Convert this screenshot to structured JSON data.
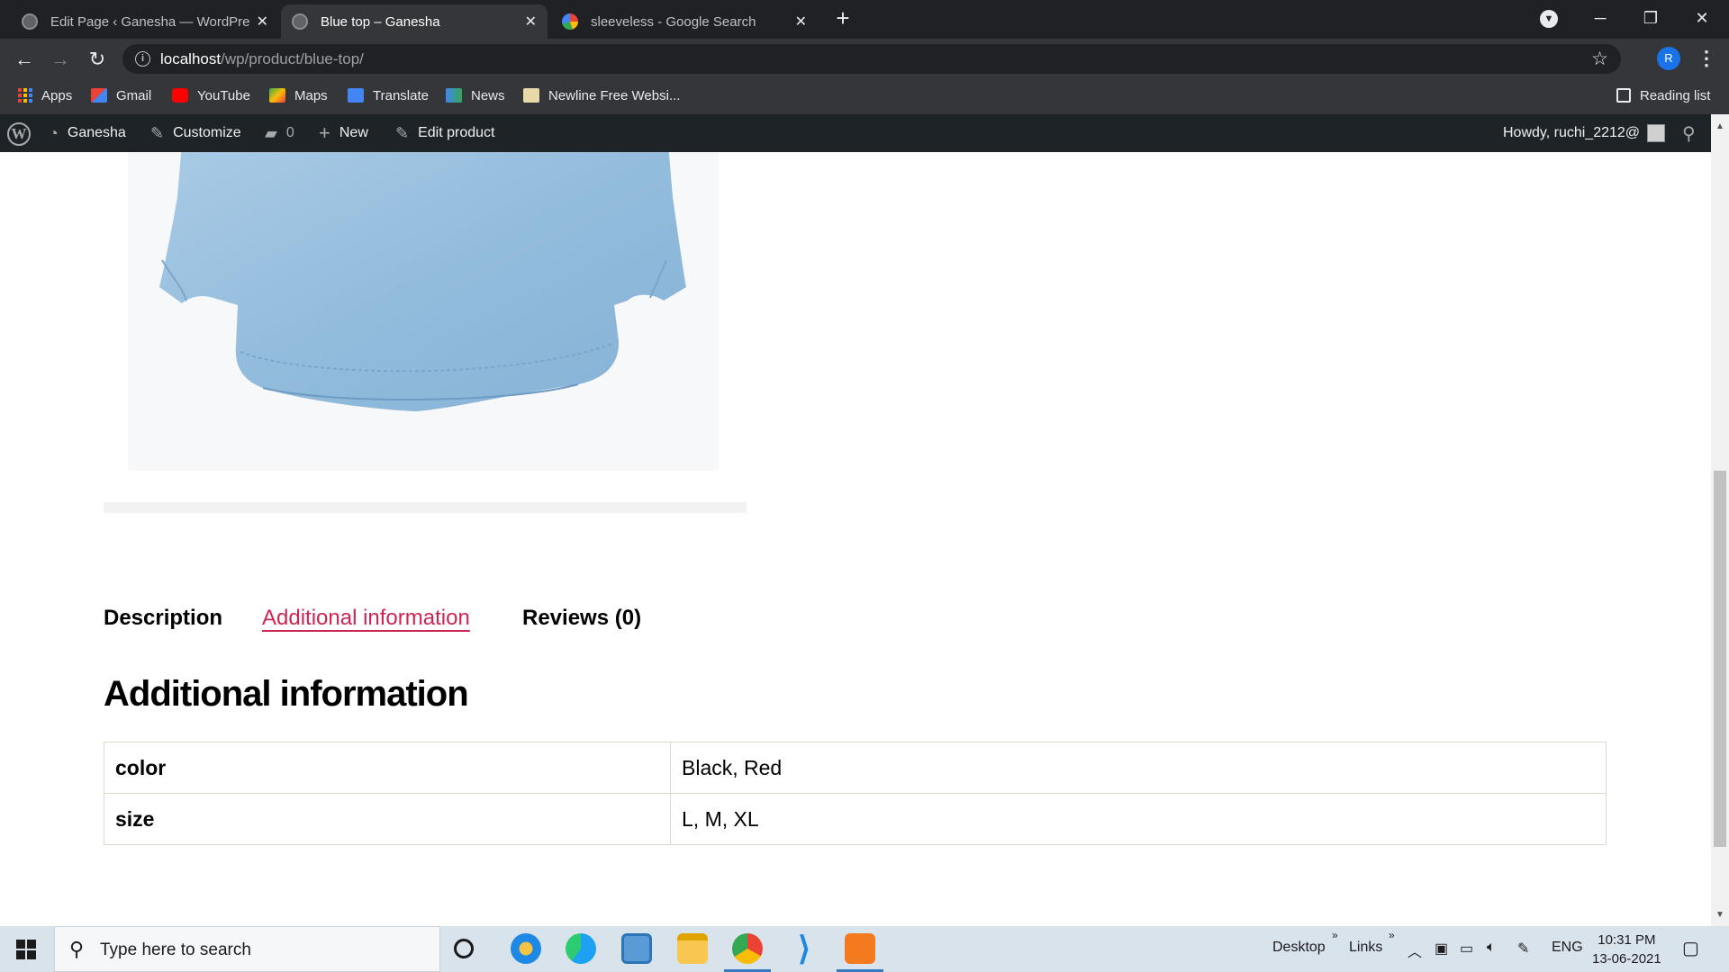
{
  "browser": {
    "tabs": [
      {
        "title": "Edit Page ‹ Ganesha — WordPress",
        "favicon": "wordpress-icon",
        "active": false
      },
      {
        "title": "Blue top – Ganesha",
        "favicon": "wordpress-icon",
        "active": true
      },
      {
        "title": "sleeveless - Google Search",
        "favicon": "google-icon",
        "active": false
      }
    ],
    "url_host": "localhost",
    "url_path": "/wp/product/blue-top/",
    "profile_initial": "R",
    "bookmarks": [
      {
        "label": "Apps",
        "icon": "apps-grid-icon"
      },
      {
        "label": "Gmail",
        "icon": "gmail-icon"
      },
      {
        "label": "YouTube",
        "icon": "youtube-icon"
      },
      {
        "label": "Maps",
        "icon": "maps-icon"
      },
      {
        "label": "Translate",
        "icon": "translate-icon"
      },
      {
        "label": "News",
        "icon": "news-icon"
      },
      {
        "label": "Newline Free Websi...",
        "icon": "bookmark-folder-icon"
      }
    ],
    "reading_list": "Reading list"
  },
  "adminbar": {
    "site_name": "Ganesha",
    "customize": "Customize",
    "comments_count": "0",
    "new_label": "New",
    "edit_label": "Edit product",
    "howdy": "Howdy, ruchi_2212@"
  },
  "product": {
    "tabs": [
      {
        "label": "Description",
        "active": false
      },
      {
        "label": "Additional information",
        "active": true
      },
      {
        "label": "Reviews (0)",
        "active": false
      }
    ],
    "section_heading": "Additional information",
    "attributes": [
      {
        "name": "color",
        "value": "Black, Red"
      },
      {
        "name": "size",
        "value": "L, M, XL"
      }
    ]
  },
  "taskbar": {
    "search_placeholder": "Type here to search",
    "desktop_label": "Desktop",
    "links_label": "Links",
    "language": "ENG",
    "time": "10:31 PM",
    "date": "13-06-2021"
  },
  "colors": {
    "accent": "#cd2653",
    "adminbar": "#1d2327",
    "chrome_dark": "#202124"
  }
}
